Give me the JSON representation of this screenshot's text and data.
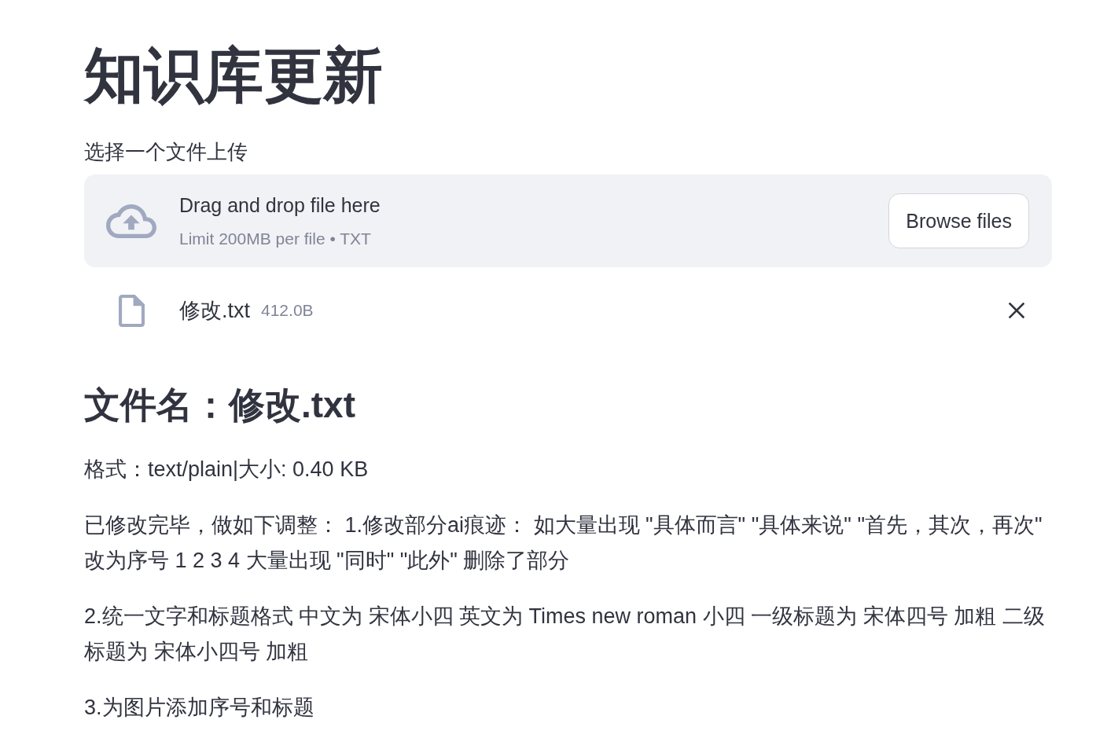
{
  "page": {
    "title": "知识库更新"
  },
  "uploader": {
    "label": "选择一个文件上传",
    "dropzone_title": "Drag and drop file here",
    "dropzone_hint": "Limit 200MB per file • TXT",
    "browse_button": "Browse files"
  },
  "uploaded_files": [
    {
      "name": "修改.txt",
      "size": "412.0B"
    }
  ],
  "file_info": {
    "heading": "文件名：修改.txt",
    "meta": "格式：text/plain|大小: 0.40 KB",
    "paragraphs": [
      "已修改完毕，做如下调整： 1.修改部分ai痕迹： 如大量出现 \"具体而言\" \"具体来说\" \"首先，其次，再次\" 改为序号 1 2 3 4 大量出现 \"同时\" \"此外\" 删除了部分",
      "2.统一文字和标题格式 中文为 宋体小四 英文为 Times new roman 小四 一级标题为 宋体四号 加粗 二级标题为 宋体小四号 加粗",
      "3.为图片添加序号和标题"
    ]
  }
}
